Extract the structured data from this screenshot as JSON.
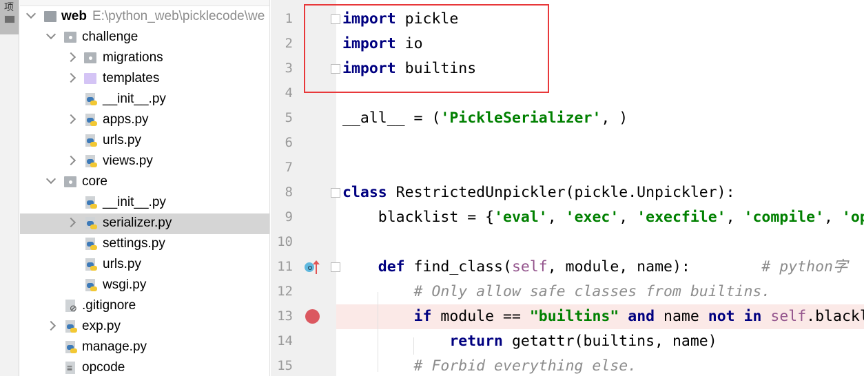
{
  "side_strip": {
    "tab_label": "项",
    "icon": "folder-icon"
  },
  "tree": {
    "root": {
      "name": "web",
      "path": "E:\\python_web\\picklecode\\we"
    },
    "items": [
      {
        "label": "challenge",
        "icon": "package-folder",
        "level": 1,
        "chevron": "down"
      },
      {
        "label": "migrations",
        "icon": "package-folder",
        "level": 2,
        "chevron": "right"
      },
      {
        "label": "templates",
        "icon": "template-folder",
        "level": 2,
        "chevron": "right"
      },
      {
        "label": "__init__.py",
        "icon": "python-file",
        "level": 2,
        "chevron": ""
      },
      {
        "label": "apps.py",
        "icon": "python-file",
        "level": 2,
        "chevron": "right"
      },
      {
        "label": "urls.py",
        "icon": "python-file",
        "level": 2,
        "chevron": ""
      },
      {
        "label": "views.py",
        "icon": "python-file",
        "level": 2,
        "chevron": "right"
      },
      {
        "label": "core",
        "icon": "package-folder",
        "level": 1,
        "chevron": "down"
      },
      {
        "label": "__init__.py",
        "icon": "python-file",
        "level": 2,
        "chevron": ""
      },
      {
        "label": "serializer.py",
        "icon": "python-file",
        "level": 2,
        "chevron": "right",
        "selected": true
      },
      {
        "label": "settings.py",
        "icon": "python-file",
        "level": 2,
        "chevron": ""
      },
      {
        "label": "urls.py",
        "icon": "python-file",
        "level": 2,
        "chevron": ""
      },
      {
        "label": "wsgi.py",
        "icon": "python-file",
        "level": 2,
        "chevron": ""
      },
      {
        "label": ".gitignore",
        "icon": "gitignore-file",
        "level": 1,
        "chevron": ""
      },
      {
        "label": "exp.py",
        "icon": "python-file",
        "level": 1,
        "chevron": "right"
      },
      {
        "label": "manage.py",
        "icon": "python-file",
        "level": 1,
        "chevron": ""
      },
      {
        "label": "opcode",
        "icon": "text-file",
        "level": 1,
        "chevron": ""
      }
    ]
  },
  "editor": {
    "highlight_color": "#fbe9e7",
    "annotation_box_color": "#e8383a",
    "lines": [
      {
        "n": "1",
        "tokens": [
          [
            "kw",
            "import"
          ],
          [
            "",
            "pickle"
          ]
        ],
        "fold": true
      },
      {
        "n": "2",
        "tokens": [
          [
            "kw",
            "import"
          ],
          [
            "",
            "io"
          ]
        ]
      },
      {
        "n": "3",
        "tokens": [
          [
            "kw",
            "import"
          ],
          [
            "",
            "builtins"
          ]
        ],
        "fold": true
      },
      {
        "n": "4",
        "tokens": []
      },
      {
        "n": "5",
        "tokens": [
          [
            "",
            "__all__ = ("
          ],
          [
            "str",
            "'PickleSerializer'"
          ],
          [
            "",
            ", )"
          ]
        ]
      },
      {
        "n": "6",
        "tokens": []
      },
      {
        "n": "7",
        "tokens": []
      },
      {
        "n": "8",
        "tokens": [
          [
            "kw",
            "class"
          ],
          [
            "",
            " RestrictedUnpickler(pickle.Unpickler):"
          ]
        ],
        "fold": true
      },
      {
        "n": "9",
        "tokens": [
          [
            "",
            "    blacklist = {"
          ],
          [
            "str",
            "'eval'"
          ],
          [
            "",
            ", "
          ],
          [
            "str",
            "'exec'"
          ],
          [
            "",
            ", "
          ],
          [
            "str",
            "'execfile'"
          ],
          [
            "",
            ", "
          ],
          [
            "str",
            "'compile'"
          ],
          [
            "",
            ", "
          ],
          [
            "str",
            "'op"
          ]
        ]
      },
      {
        "n": "10",
        "tokens": []
      },
      {
        "n": "11",
        "tokens": [
          [
            "kw",
            "    def"
          ],
          [
            "",
            " find_class("
          ],
          [
            "self",
            "self"
          ],
          [
            "",
            ", module, name):        "
          ],
          [
            "cm",
            "# python字"
          ]
        ],
        "fold": true,
        "marker": "override"
      },
      {
        "n": "12",
        "tokens": [
          [
            "cm",
            "        # Only allow safe classes from builtins."
          ]
        ]
      },
      {
        "n": "13",
        "tokens": [
          [
            "kw",
            "        if"
          ],
          [
            "",
            " module == "
          ],
          [
            "str",
            "\"builtins\""
          ],
          [
            "",
            " "
          ],
          [
            "kw",
            "and"
          ],
          [
            "",
            " name "
          ],
          [
            "kw",
            "not in"
          ],
          [
            "",
            " "
          ],
          [
            "self",
            "self"
          ],
          [
            "",
            ".blackl"
          ]
        ],
        "marker": "breakpoint",
        "highlight": true
      },
      {
        "n": "14",
        "tokens": [
          [
            "kw",
            "            return"
          ],
          [
            "",
            " getattr(builtins, name)"
          ]
        ]
      },
      {
        "n": "15",
        "tokens": [
          [
            "cm",
            "        # Forbid everything else."
          ]
        ]
      }
    ]
  }
}
